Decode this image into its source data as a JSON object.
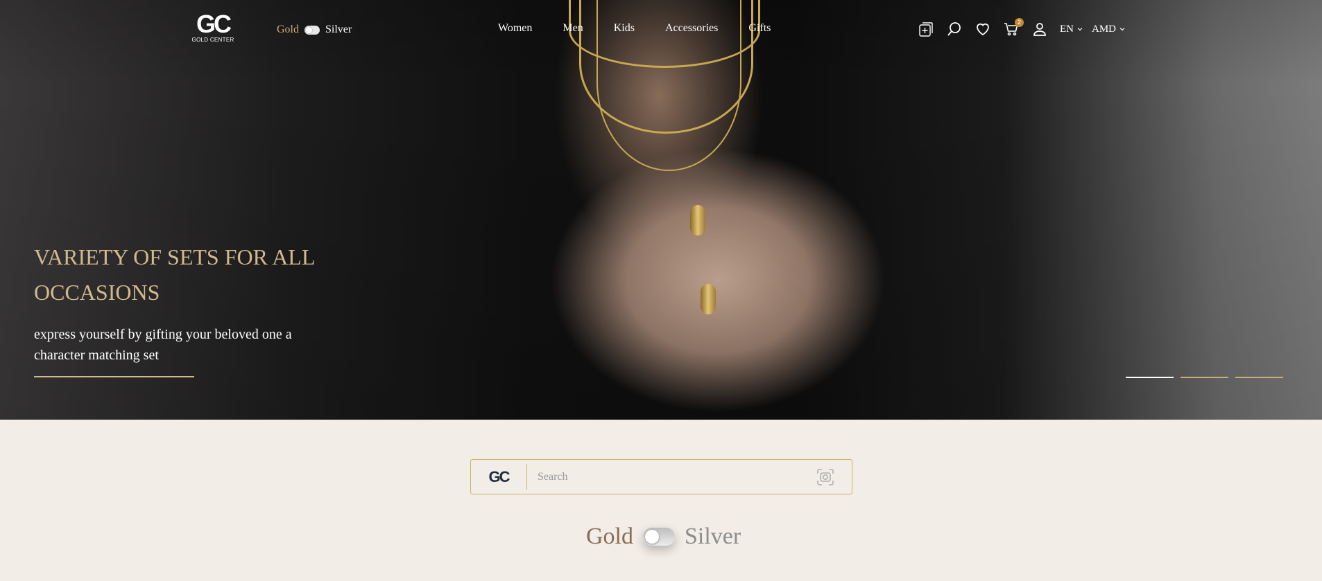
{
  "header": {
    "logo": {
      "mark": "GC",
      "sub": "GOLD CENTER"
    },
    "metal_toggle": {
      "gold": "Gold",
      "silver": "Silver"
    },
    "nav": [
      "Women",
      "Men",
      "Kids",
      "Accessories",
      "Gifts"
    ],
    "icons": [
      "add-to-compare-icon",
      "search-icon",
      "heart-icon",
      "cart-icon",
      "user-icon"
    ],
    "cart_count": "2",
    "language": "EN",
    "currency": "AMD"
  },
  "hero": {
    "title": "VARIETY OF SETS FOR ALL OCCASIONS",
    "subtitle": "express yourself by gifting your beloved one a character matching set",
    "slides": 3,
    "active_slide": 1,
    "colors": {
      "title": "#d2b98d",
      "accent": "#c9ad7b"
    }
  },
  "search": {
    "logo": "GC",
    "placeholder": "Search",
    "icon": "camera-icon"
  },
  "metal_switch": {
    "gold": "Gold",
    "silver": "Silver"
  }
}
